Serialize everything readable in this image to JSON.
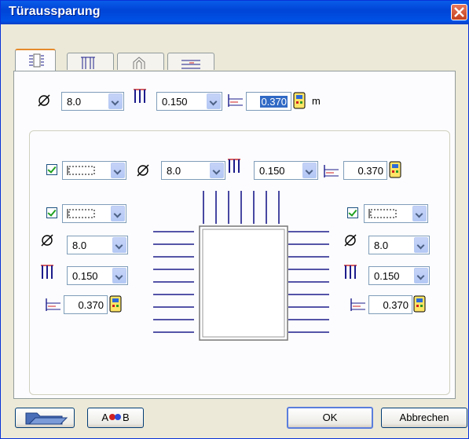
{
  "window": {
    "title": "Türaussparung"
  },
  "tabs": [
    {
      "name": "tab-reveal",
      "icon": "reveal-icon"
    },
    {
      "name": "tab-frame",
      "icon": "door-frame-icon"
    },
    {
      "name": "tab-arch",
      "icon": "arch-icon"
    },
    {
      "name": "tab-layers",
      "icon": "layer-lines-icon"
    }
  ],
  "global": {
    "diameter": "8.0",
    "spacing": "0.150",
    "offset": "0.370",
    "unit": "m"
  },
  "top_side": {
    "diameter": "8.0",
    "spacing": "0.150",
    "offset": "0.370"
  },
  "left_side": {
    "diameter": "8.0",
    "spacing": "0.150",
    "offset": "0.370"
  },
  "right_side": {
    "diameter": "8.0",
    "spacing": "0.150",
    "offset": "0.370"
  },
  "buttons": {
    "ok": "OK",
    "cancel": "Abbrechen",
    "ab": "A●●B"
  },
  "colors": {
    "accent": "#0831d9",
    "line": "#1c1c8c",
    "check": "#21a121"
  }
}
